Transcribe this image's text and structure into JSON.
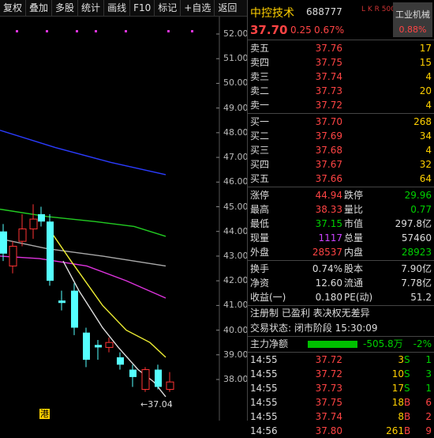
{
  "toolbar": {
    "buttons": [
      "复权",
      "叠加",
      "多股",
      "统计",
      "画线",
      "F10",
      "标记",
      "+自选",
      "返回"
    ]
  },
  "chart": {
    "y_labels": [
      "52.00",
      "51.00",
      "50.00",
      "49.00",
      "48.00",
      "47.00",
      "46.00",
      "45.00",
      "44.00",
      "43.00",
      "42.00",
      "41.00",
      "40.00",
      "39.00",
      "38.00"
    ],
    "low_marker": "←37.04",
    "hk_tag": "港"
  },
  "chart_data": {
    "type": "candlestick",
    "y_range": [
      37.5,
      52.3
    ],
    "candles": [
      {
        "open": 44.0,
        "close": 43.1,
        "high": 44.3,
        "low": 42.8,
        "color": "cyan"
      },
      {
        "open": 42.6,
        "close": 43.4,
        "high": 43.6,
        "low": 42.3,
        "color": "red"
      },
      {
        "open": 43.6,
        "close": 44.1,
        "high": 44.7,
        "low": 43.4,
        "color": "red"
      },
      {
        "open": 44.1,
        "close": 44.5,
        "high": 45.1,
        "low": 43.7,
        "color": "red"
      },
      {
        "open": 44.7,
        "close": 44.4,
        "high": 45.0,
        "low": 44.2,
        "color": "cyan"
      },
      {
        "open": 44.4,
        "close": 42.0,
        "high": 44.7,
        "low": 41.8,
        "color": "cyan"
      },
      {
        "open": 41.2,
        "close": 41.1,
        "high": 41.6,
        "low": 40.8,
        "color": "cyan"
      },
      {
        "open": 41.6,
        "close": 40.1,
        "high": 41.9,
        "low": 39.8,
        "color": "cyan"
      },
      {
        "open": 39.9,
        "close": 38.8,
        "high": 40.1,
        "low": 38.5,
        "color": "cyan"
      },
      {
        "open": 39.4,
        "close": 39.3,
        "high": 39.6,
        "low": 38.8,
        "color": "cyan"
      },
      {
        "open": 39.5,
        "close": 39.3,
        "high": 39.7,
        "low": 39.1,
        "color": "red"
      },
      {
        "open": 38.9,
        "close": 38.6,
        "high": 39.1,
        "low": 38.4,
        "color": "cyan"
      },
      {
        "open": 38.4,
        "close": 38.1,
        "high": 38.6,
        "low": 37.7,
        "color": "cyan"
      },
      {
        "open": 37.6,
        "close": 38.4,
        "high": 38.5,
        "low": 37.5,
        "color": "red"
      },
      {
        "open": 38.4,
        "close": 37.7,
        "high": 38.6,
        "low": 37.6,
        "color": "cyan"
      },
      {
        "open": 37.6,
        "close": 37.9,
        "high": 38.3,
        "low": 37.5,
        "color": "red"
      }
    ],
    "ma_lines": [
      {
        "name": "MA-blue",
        "color": "#2b3cff",
        "points": [
          [
            0,
            48.1
          ],
          [
            70,
            47.4
          ],
          [
            140,
            46.8
          ],
          [
            210,
            46.3
          ]
        ]
      },
      {
        "name": "MA-green",
        "color": "#22cc22",
        "points": [
          [
            0,
            44.9
          ],
          [
            60,
            44.6
          ],
          [
            120,
            44.4
          ],
          [
            170,
            44.2
          ],
          [
            210,
            43.8
          ]
        ]
      },
      {
        "name": "MA-gray",
        "color": "#aaaaaa",
        "points": [
          [
            0,
            43.7
          ],
          [
            60,
            43.3
          ],
          [
            130,
            43.0
          ],
          [
            210,
            42.6
          ]
        ]
      },
      {
        "name": "MA-magenta",
        "color": "#dd33dd",
        "points": [
          [
            0,
            43.0
          ],
          [
            50,
            42.9
          ],
          [
            110,
            42.6
          ],
          [
            160,
            42.0
          ],
          [
            210,
            41.3
          ]
        ]
      },
      {
        "name": "MA-yellow",
        "color": "#eeee33",
        "points": [
          [
            60,
            44.2
          ],
          [
            90,
            42.8
          ],
          [
            130,
            41.0
          ],
          [
            160,
            40.0
          ],
          [
            190,
            39.5
          ],
          [
            210,
            38.9
          ]
        ]
      },
      {
        "name": "MA-white",
        "color": "#dddddd",
        "points": [
          [
            80,
            42.8
          ],
          [
            100,
            41.6
          ],
          [
            130,
            40.1
          ],
          [
            150,
            39.3
          ],
          [
            175,
            38.4
          ],
          [
            195,
            37.9
          ],
          [
            210,
            37.3
          ]
        ]
      }
    ],
    "markers_magenta_dots_count": 7
  },
  "stock": {
    "name": "中控技术",
    "code": "688777",
    "badge": "L K R 500",
    "price": "37.70",
    "change": "0.25",
    "change_pct": "0.67%",
    "industry": "工业机械",
    "industry_pct": "0.88%"
  },
  "order_book": {
    "asks": [
      {
        "label": "卖五",
        "price": "37.76",
        "vol": "17"
      },
      {
        "label": "卖四",
        "price": "37.75",
        "vol": "15"
      },
      {
        "label": "卖三",
        "price": "37.74",
        "vol": "4"
      },
      {
        "label": "卖二",
        "price": "37.73",
        "vol": "20"
      },
      {
        "label": "卖一",
        "price": "37.72",
        "vol": "4"
      }
    ],
    "bids": [
      {
        "label": "买一",
        "price": "37.70",
        "vol": "268"
      },
      {
        "label": "买二",
        "price": "37.69",
        "vol": "34"
      },
      {
        "label": "买三",
        "price": "37.68",
        "vol": "4"
      },
      {
        "label": "买四",
        "price": "37.67",
        "vol": "32"
      },
      {
        "label": "买五",
        "price": "37.66",
        "vol": "64"
      }
    ]
  },
  "stats": [
    {
      "l1": "涨停",
      "v1": "44.94",
      "c1": "red",
      "l2": "跌停",
      "v2": "29.96",
      "c2": "green"
    },
    {
      "l1": "最高",
      "v1": "38.33",
      "c1": "red",
      "l2": "量比",
      "v2": "0.77",
      "c2": "green"
    },
    {
      "l1": "最低",
      "v1": "37.15",
      "c1": "green",
      "l2": "市值",
      "v2": "297.8亿",
      "c2": "white"
    },
    {
      "l1": "现量",
      "v1": "1117",
      "c1": "purple",
      "l2": "总量",
      "v2": "57460",
      "c2": "white"
    },
    {
      "l1": "外盘",
      "v1": "28537",
      "c1": "red",
      "l2": "内盘",
      "v2": "28923",
      "c2": "green"
    }
  ],
  "fundamentals": [
    {
      "l1": "换手",
      "v1": "0.74%",
      "l2": "股本",
      "v2": "7.90亿"
    },
    {
      "l1": "净资",
      "v1": "12.60",
      "l2": "流通",
      "v2": "7.78亿"
    },
    {
      "l1": "收益(一)",
      "v1": "0.180",
      "l2": "PE(动)",
      "v2": "51.2"
    }
  ],
  "flags": "注册制 已盈利 表决权无差异",
  "trade_status": "交易状态: 闭市阶段 15:30:09",
  "main_flow": {
    "label": "主力净额",
    "value": "-505.8万",
    "pct": "-2%"
  },
  "ticks": [
    {
      "time": "14:55",
      "price": "37.72",
      "vol": "3",
      "side": "S"
    },
    {
      "time": "14:55",
      "price": "37.72",
      "vol": "10",
      "side": "S"
    },
    {
      "time": "14:55",
      "price": "37.73",
      "vol": "17",
      "side": "S"
    },
    {
      "time": "14:55",
      "price": "37.75",
      "vol": "18",
      "side": "B"
    },
    {
      "time": "14:55",
      "price": "37.74",
      "vol": "8",
      "side": "B"
    },
    {
      "time": "14:56",
      "price": "37.80",
      "vol": "261",
      "side": "B"
    }
  ]
}
